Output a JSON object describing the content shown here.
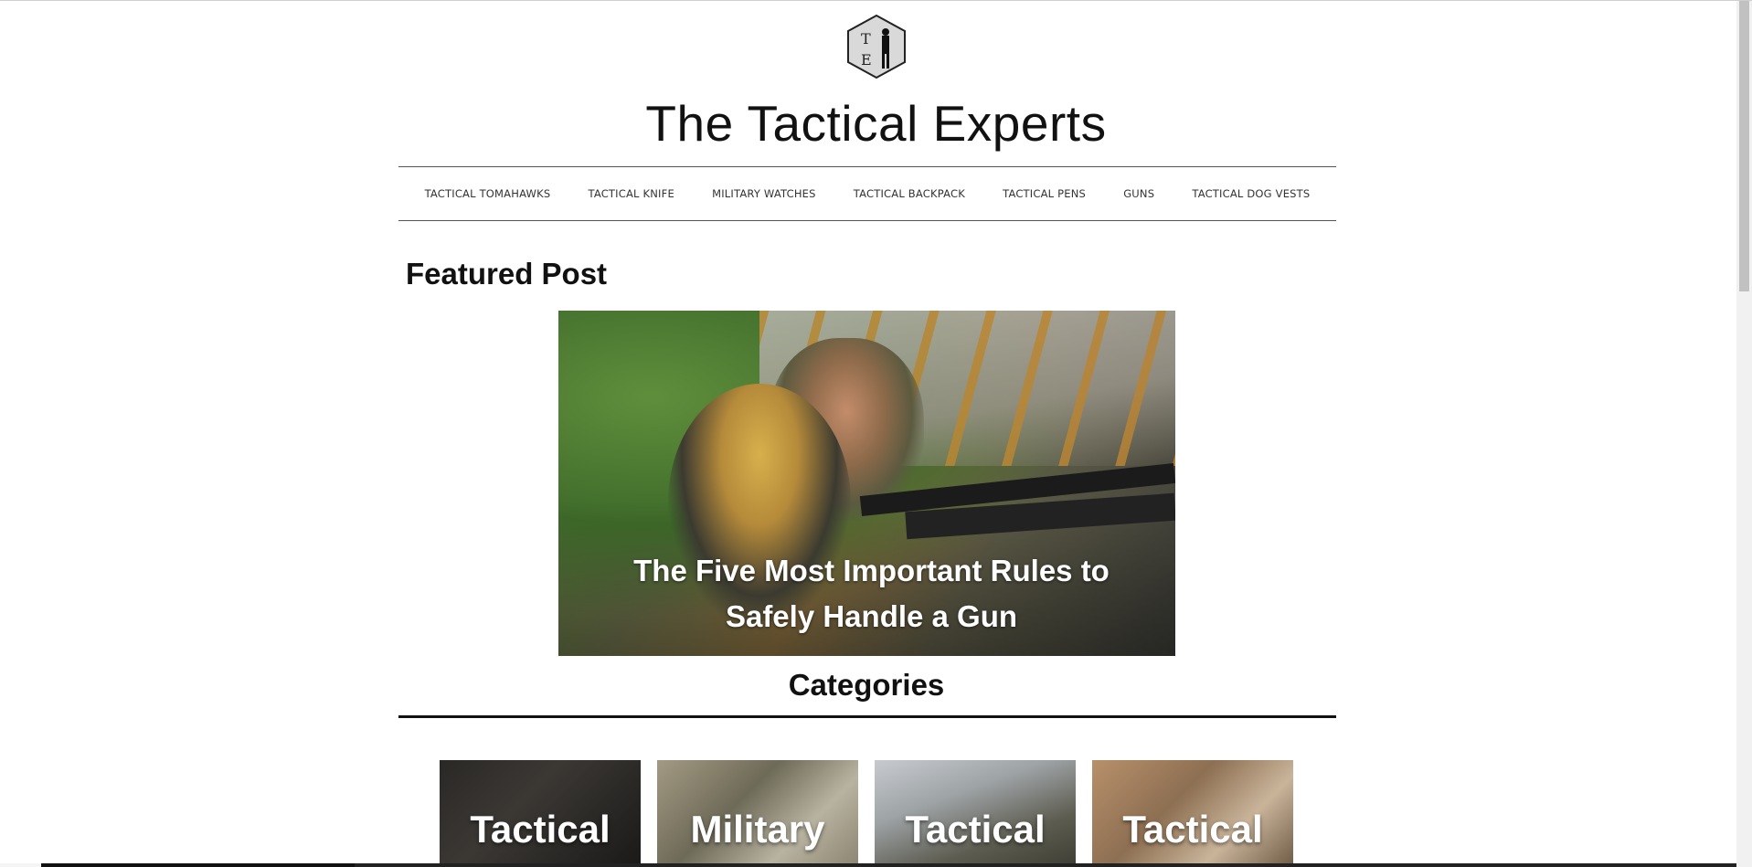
{
  "site": {
    "logo_letters": "T E",
    "title": "The Tactical Experts"
  },
  "nav": {
    "items": [
      {
        "label": "TACTICAL TOMAHAWKS"
      },
      {
        "label": "TACTICAL KNIFE"
      },
      {
        "label": "MILITARY WATCHES"
      },
      {
        "label": "TACTICAL BACKPACK"
      },
      {
        "label": "TACTICAL PENS"
      },
      {
        "label": "GUNS"
      },
      {
        "label": "TACTICAL DOG VESTS"
      }
    ]
  },
  "featured": {
    "heading": "Featured Post",
    "post_title": "The Five Most Important Rules to Safely Handle a Gun"
  },
  "categories": {
    "heading": "Categories",
    "tiles": [
      {
        "label": "Tactical"
      },
      {
        "label": "Military"
      },
      {
        "label": "Tactical"
      },
      {
        "label": "Tactical"
      }
    ]
  },
  "colors": {
    "text": "#111111",
    "rule": "#555555",
    "caption": "#ffffff"
  }
}
